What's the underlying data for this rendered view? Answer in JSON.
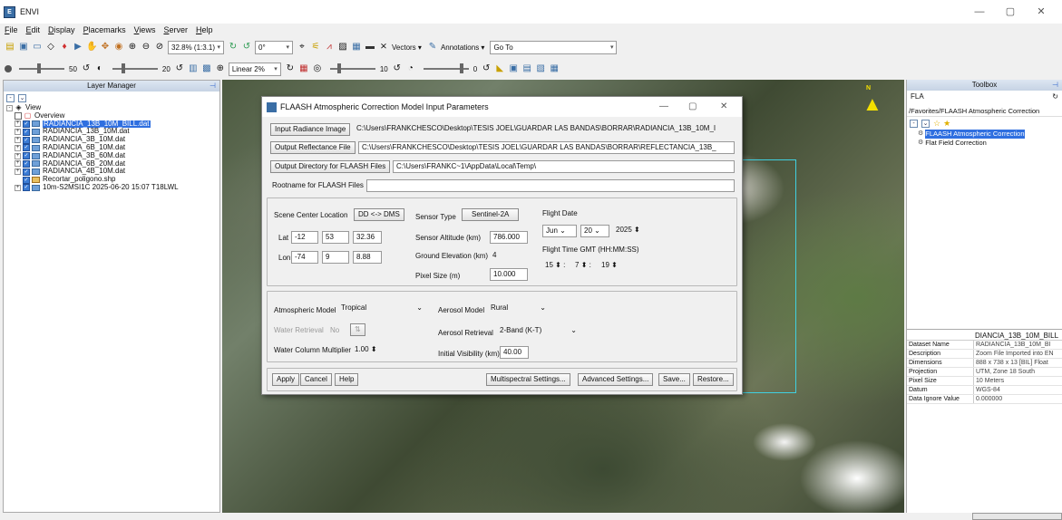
{
  "app": {
    "title": "ENVI",
    "icon": "envi-app-icon",
    "min": "—",
    "max": "▢",
    "close": "✕"
  },
  "menu": [
    "File",
    "Edit",
    "Display",
    "Placemarks",
    "Views",
    "Server",
    "Help"
  ],
  "toolbar1": {
    "zoom": "32.8% (1:3.1)",
    "rotation": "0°",
    "vectors": "Vectors",
    "annotations": "Annotations",
    "goto_label": "Go To"
  },
  "toolbar2": {
    "brightness": "50",
    "contrast": "20",
    "stretch": "Linear 2%",
    "sharpen": "10",
    "transparency": "0"
  },
  "layer_manager": {
    "title": "Layer Manager",
    "root": "View",
    "items": [
      "Overview",
      "RADIANCIA_13B_10M_BILL.dat",
      "RADIANCIA_13B_10M.dat",
      "RADIANCIA_3B_10M.dat",
      "RADIANCIA_6B_10M.dat",
      "RADIANCIA_3B_60M.dat",
      "RADIANCIA_6B_20M.dat",
      "RADIANCIA_4B_10M.dat",
      "Recortar_poligono.shp",
      "10m-S2MSI1C 2025-06-20 15:07 T18LWL"
    ]
  },
  "toolbox": {
    "title": "Toolbox",
    "search": "FLA",
    "path": "/Favorites/FLAASH Atmospheric Correction",
    "tools": [
      "FLAASH Atmospheric Correction",
      "Flat Field Correction"
    ],
    "meta_title": "DIANCIA_13B_10M_BILL",
    "meta": [
      {
        "k": "Dataset Name",
        "v": "RADIANCIA_13B_10M_BI"
      },
      {
        "k": "Description",
        "v": "Zoom File Imported into EN"
      },
      {
        "k": "Dimensions",
        "v": "888 x 738 x 13 [BIL] Float"
      },
      {
        "k": "Projection",
        "v": "UTM, Zone 18 South"
      },
      {
        "k": "Pixel Size",
        "v": "10 Meters"
      },
      {
        "k": "Datum",
        "v": "WGS-84"
      },
      {
        "k": "Data Ignore Value",
        "v": "0.000000"
      }
    ]
  },
  "dialog": {
    "title": "FLAASH Atmospheric Correction Model Input Parameters",
    "input_radiance_btn": "Input Radiance Image",
    "input_radiance_val": "C:\\Users\\FRANKCHESCO\\Desktop\\TESIS JOEL\\GUARDAR LAS BANDAS\\BORRAR\\RADIANCIA_13B_10M_I",
    "output_refl_btn": "Output Reflectance File",
    "output_refl_val": "C:\\Users\\FRANKCHESCO\\Desktop\\TESIS JOEL\\GUARDAR LAS BANDAS\\BORRAR\\REFLECTANCIA_13B_",
    "output_dir_btn": "Output Directory for FLAASH Files",
    "output_dir_val": "C:\\Users\\FRANKC~1\\AppData\\Local\\Temp\\",
    "rootname_label": "Rootname for FLAASH Files",
    "rootname_val": "",
    "scene_center": "Scene Center Location",
    "dd_dms": "DD <-> DMS",
    "lat_label": "Lat",
    "lat": [
      "-12",
      "53",
      "32.36"
    ],
    "lon_label": "Lon",
    "lon": [
      "-74",
      "9",
      "8.88"
    ],
    "sensor_type_label": "Sensor Type",
    "sensor_type": "Sentinel-2A",
    "sensor_alt_label": "Sensor Altitude (km)",
    "sensor_alt": "786.000",
    "ground_elev_label": "Ground Elevation (km)",
    "ground_elev": "4",
    "pixel_size_label": "Pixel Size (m)",
    "pixel_size": "10.000",
    "flight_date_label": "Flight Date",
    "month": "Jun",
    "day": "20",
    "year": "2025",
    "flight_time_label": "Flight Time GMT (HH:MM:SS)",
    "hh": "15",
    "mm": "7",
    "ss": "19",
    "atm_model_label": "Atmospheric Model",
    "atm_model": "Tropical",
    "aerosol_model_label": "Aerosol Model",
    "aerosol_model": "Rural",
    "water_retrieval_label": "Water Retrieval",
    "water_retrieval": "No",
    "aerosol_retrieval_label": "Aerosol Retrieval",
    "aerosol_retrieval": "2-Band (K-T)",
    "wcm_label": "Water Column Multiplier",
    "wcm": "1.00",
    "visibility_label": "Initial Visibility (km)",
    "visibility": "40.00",
    "apply": "Apply",
    "cancel": "Cancel",
    "help": "Help",
    "multispectral": "Multispectral Settings...",
    "advanced": "Advanced Settings...",
    "save": "Save...",
    "restore": "Restore..."
  }
}
